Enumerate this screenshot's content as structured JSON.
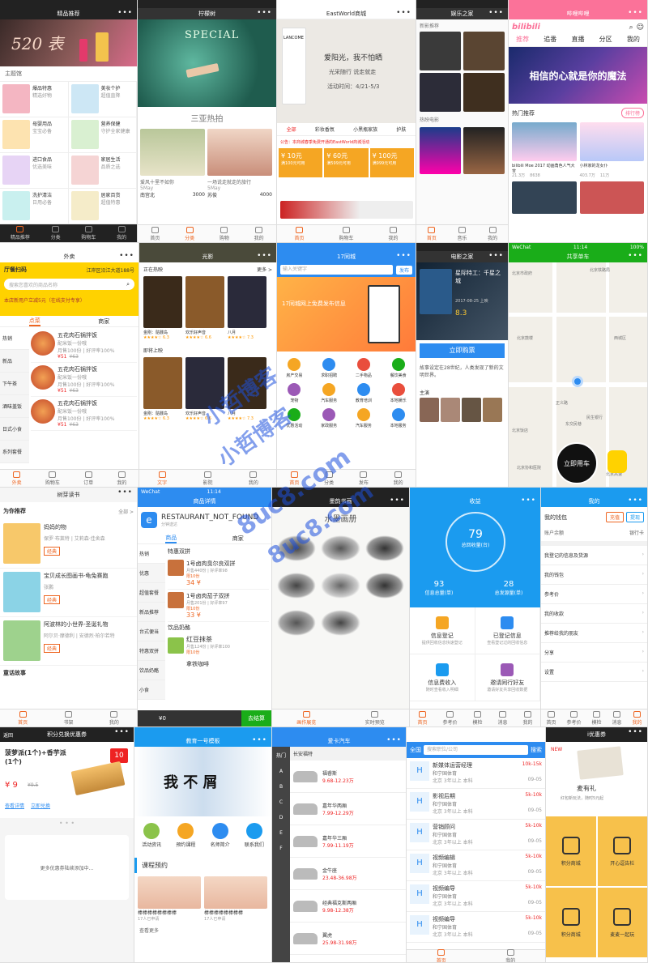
{
  "t1": {
    "title": "精品推荐",
    "hero": "520 表",
    "section": "主题馆",
    "cards": [
      {
        "a": "爆品特惠",
        "b": "精选好物"
      },
      {
        "a": "美妆个护",
        "b": "超值直降"
      },
      {
        "a": "母婴用品",
        "b": "宝宝必备"
      },
      {
        "a": "营养保健",
        "b": "守护全家健康"
      },
      {
        "a": "进口食品",
        "b": "优选美味"
      },
      {
        "a": "家居生活",
        "b": "品质之选"
      },
      {
        "a": "洗护清洁",
        "b": "日用必备"
      },
      {
        "a": "居家百货",
        "b": "超值特惠"
      }
    ],
    "tabs": [
      "精品推荐",
      "分类",
      "购物车",
      "我的"
    ]
  },
  "t2": {
    "title": "柠檬树",
    "hero": "SPECIAL",
    "section": "三亚热拍",
    "captions": [
      "爱风十里不如你",
      "一场说走就走的旅行"
    ],
    "meta": [
      "5May",
      "5May"
    ],
    "likes": [
      "3000",
      "4000"
    ],
    "names": [
      "南宫北",
      "苏俊"
    ],
    "tabs": [
      "首页",
      "分类",
      "购物",
      "我的"
    ]
  },
  "t3": {
    "title": "EastWorld商城",
    "brand": "LANCOME",
    "h1": "爱阳光，我不怕晒",
    "h2": "光采随行 说走就走",
    "h3": "活动时间：4/21-5/3",
    "tabs": [
      "全部",
      "彩妆香氛",
      "小黑瓶家族",
      "护肤"
    ],
    "notice": "公告：本商城春季免费开通的EastWorld商城活动",
    "coupons": [
      {
        "v": "¥ 10元",
        "c": "满100元可用"
      },
      {
        "v": "¥ 60元",
        "c": "满599元可用"
      },
      {
        "v": "¥ 100元",
        "c": "满999元可用"
      }
    ],
    "bottom": [
      "首页",
      "购物车",
      "我的"
    ]
  },
  "t4": {
    "title": "娱乐之家",
    "sec1": "新影推荐",
    "sec2": "热映电影",
    "tabs": [
      "首页",
      "音乐",
      "我的"
    ]
  },
  "t5": {
    "title": "哔哩哔哩",
    "logo": "bilibili",
    "nav": [
      "推荐",
      "追番",
      "直播",
      "分区",
      "我的"
    ],
    "banner": "相信的心就是你的魔法",
    "sec": "热门推荐",
    "more": "排行榜",
    "items": [
      {
        "t": "bilibili Moe 2017 动画角色人气大赏",
        "v": "21.3万",
        "d": "8638"
      },
      {
        "t": "小林家的龙女仆",
        "v": "403.7万",
        "d": "11万"
      }
    ]
  },
  "t6": {
    "title": "外卖",
    "loc": "江岸区沿江大道188号",
    "scan": "厅餐扫码",
    "search": "搜索您喜欢的商品名称",
    "notice": "本店新用户立减5元（在线支付专享）",
    "tabs": [
      "点菜",
      "商家"
    ],
    "cats": [
      "热销",
      "新品",
      "下午茶",
      "酒味盖饭",
      "日式小食",
      "系列套餐"
    ],
    "items": [
      {
        "n": "五花肉石锅拌饭",
        "d": "配米饭一份哦",
        "m": "月售100份 | 好评率100%",
        "p": "¥51",
        "o": "¥63"
      },
      {
        "n": "五花肉石锅拌饭",
        "d": "配米饭一份哦",
        "m": "月售100份 | 好评率100%",
        "p": "¥51",
        "o": "¥63"
      },
      {
        "n": "五花肉石锅拌饭",
        "d": "配米饭一份哦",
        "m": "月售100份 | 好评率100%",
        "p": "¥51",
        "o": "¥63"
      }
    ],
    "bottom": [
      "外卖",
      "购物车",
      "订单",
      "我的"
    ]
  },
  "t7": {
    "title": "光影",
    "sec1": "正在热映",
    "more": "更多 >",
    "sec2": "即将上映",
    "films": [
      "金刚：骷髅岛",
      "欢乐好声音",
      "八月"
    ],
    "scores": [
      "6.3",
      "6.6",
      "7.3"
    ],
    "tabs": [
      "文字",
      "影院",
      "我的"
    ]
  },
  "t8": {
    "title": "17同城",
    "search": "输入关键字",
    "post": "发布",
    "banner": "17同城网上免费发布信息",
    "cats": [
      "房产交易",
      "求职招聘",
      "二手物品",
      "餐饮美食",
      "宠物",
      "汽车服务",
      "教育培训",
      "本地娱乐",
      "优惠活动",
      "家政服务",
      "汽车服务",
      "本地服务"
    ],
    "tabs": [
      "首页",
      "分类",
      "发布",
      "我的"
    ]
  },
  "t9": {
    "title": "电影之家",
    "movie": "星际特工：千星之城",
    "info": "2017-08-25 上映",
    "score": "8.3",
    "buy": "立即购票",
    "desc": "故事设定在28世纪，人类发现了新的文明世界。",
    "sec": "主演"
  },
  "t10": {
    "title": "共享单车",
    "status": "WeChat",
    "time": "11:14",
    "battery": "100%",
    "poi": [
      "北京市政府",
      "北京铁路局",
      "北京鼓楼",
      "西城区",
      "正义路",
      "东交民巷",
      "北京饭店",
      "民生银行",
      "北京协和医院",
      "北京高速"
    ],
    "ride": "立即用车"
  },
  "t11": {
    "title": "树芽读书",
    "sec1": "为你推荐",
    "more": "全部 >",
    "books": [
      {
        "t": "妈妈的物",
        "a": "保罗·布莱特 | 艾莉森·佳舍森",
        "tag": "经典"
      },
      {
        "t": "宝贝成长图画书-龟兔赛跑",
        "a": "张鹏",
        "tag": "经典"
      },
      {
        "t": "阿波林的小世界-圣诞礼物",
        "a": "阿尔贝·摩德利 | 安德烈·柏尔若特",
        "tag": "经典"
      }
    ],
    "sec2": "童话故事",
    "tabs": [
      "首页",
      "书架",
      "我的"
    ]
  },
  "t12": {
    "status": "WeChat",
    "time": "11:14",
    "title": "商品详情",
    "shop": "RESTAURANT_NOT_FOUND",
    "sub": "分钟送达",
    "tabs": [
      "商品",
      "商家"
    ],
    "cats": [
      "热销",
      "优惠",
      "超值套餐",
      "新品推荐",
      "台式便当",
      "特惠双拼",
      "饮品奶酪",
      "小食"
    ],
    "sec1": "特惠双拼",
    "items": [
      {
        "n": "1号卤肉臭尔良双拼",
        "m": "月售440份 | 好评率98",
        "l": "限10份",
        "p": "34 ¥"
      },
      {
        "n": "1号卤肉茄子双拼",
        "m": "月售201份 | 好评率97",
        "l": "限10份",
        "p": "33 ¥"
      }
    ],
    "sec2": "饮品奶酪",
    "items2": [
      {
        "n": "红豆抹茶",
        "m": "月售124份 | 好评率100",
        "l": "限10份"
      },
      {
        "n": "拿铁咖啡"
      }
    ],
    "cart": "¥0",
    "go": "去结算"
  },
  "t13": {
    "title": "墨韵书画",
    "banner": "水墨画册",
    "tabs": [
      "画作展览",
      "实时预览"
    ]
  },
  "t14": {
    "title": "收益",
    "num": "79",
    "label": "总回收量(台)",
    "stats": [
      {
        "v": "93",
        "l": "信息总量(单)"
      },
      {
        "v": "28",
        "l": "总发源量(单)"
      }
    ],
    "grid": [
      {
        "t": "信息登记",
        "s": "提供回收信息快速登记"
      },
      {
        "t": "已登记信息",
        "s": "查看登记过的回收信息"
      },
      {
        "t": "信息费收入",
        "s": "随时查看收入明细"
      },
      {
        "t": "邀请同行好友",
        "s": "邀请好友共享回收数据"
      }
    ],
    "tabs": [
      "首页",
      "参考价",
      "模检",
      "消息",
      "我的"
    ]
  },
  "t15": {
    "title": "我的",
    "wallet": "我的钱包",
    "charge": "充值",
    "withdraw": "提现",
    "acc": "账户余额",
    "card": "银行卡",
    "rows": [
      "我登记的信息及货源",
      "我的钱包",
      "参考价",
      "我的收款",
      "推荐给我的朋友",
      "分享",
      "设置"
    ],
    "tabs": [
      "首页",
      "参考价",
      "模检",
      "消息",
      "我的"
    ]
  },
  "t16": {
    "title": "积分兑换优惠券",
    "back": "返回",
    "prod": "菠萝派(1个)+香芋派(1个)",
    "price": "¥ 9",
    "orig": "¥9.5",
    "num": "10",
    "links": [
      "查看详情",
      "立即兑换"
    ],
    "more": "更多优惠券陆续添加中..."
  },
  "t17": {
    "title": "教育一号模板",
    "hero": "我 不 屑",
    "icons": [
      "活动资讯",
      "预约课程",
      "名师简介",
      "联系我们"
    ],
    "sec": "课程预约",
    "courses": [
      {
        "t": "棒棒棒棒棒棒棒棒",
        "n": "17人已申请"
      },
      {
        "t": "棒棒棒棒棒棒棒棒",
        "n": "17人已申请"
      }
    ],
    "more": "查看更多"
  },
  "t18": {
    "title": "爱卡汽车",
    "brand": "长安福特",
    "cars": [
      {
        "n": "福睿斯",
        "p": "9.68-12.23万"
      },
      {
        "n": "嘉年华两厢",
        "p": "7.99-12.29万"
      },
      {
        "n": "嘉年华三厢",
        "p": "7.99-11.19万"
      },
      {
        "n": "金牛座",
        "p": "23.48-36.98万"
      },
      {
        "n": "经典福克斯两厢",
        "p": "9.98-12.38万"
      },
      {
        "n": "翼虎",
        "p": "25.98-31.98万"
      }
    ],
    "side": [
      "热门",
      "A",
      "B",
      "C",
      "D",
      "E",
      "F"
    ]
  },
  "t19": {
    "region": "全国",
    "search": "搜索职位/公司",
    "btn": "搜索",
    "jobs": [
      {
        "t": "新媒体运营经理",
        "s": "10k-15k",
        "c": "和宁国体育",
        "l": "北京 3年以上 本科",
        "d": "09-05"
      },
      {
        "t": "影视后期",
        "s": "5k-10k",
        "c": "和宁国体育",
        "l": "北京 3年以上 本科",
        "d": "09-05"
      },
      {
        "t": "营销顾问",
        "s": "5k-10k",
        "c": "和宁国体育",
        "l": "北京 3年以上 本科",
        "d": "09-05"
      },
      {
        "t": "视频编辑",
        "s": "5k-10k",
        "c": "和宁国体育",
        "l": "北京 3年以上 本科",
        "d": "09-05"
      },
      {
        "t": "视频编导",
        "s": "5k-10k",
        "c": "和宁国体育",
        "l": "北京 3年以上 本科",
        "d": "09-05"
      },
      {
        "t": "视频编导",
        "s": "5k-10k",
        "c": "和宁国体育",
        "l": "北京 3年以上 本科",
        "d": "09-05"
      }
    ],
    "tabs": [
      "首页",
      "我的"
    ]
  },
  "t20": {
    "title": "i优惠券",
    "new": "NEW",
    "gift": "麦有礼",
    "sub": "红包新玩法，随时5元起",
    "grid": [
      "积分商城",
      "开心逗告栏",
      "积分商城",
      "麦麦一起玩"
    ]
  },
  "wm": {
    "a": "小哲博客",
    "b": "8uc8.com"
  },
  "colors": {
    "orange": "#f5a623",
    "yellow": "#ffd200",
    "blue": "#2d8cf0",
    "pink": "#fb7299",
    "red": "#e22d2d",
    "green": "#1aad19",
    "wxblue": "#1b9bef"
  }
}
